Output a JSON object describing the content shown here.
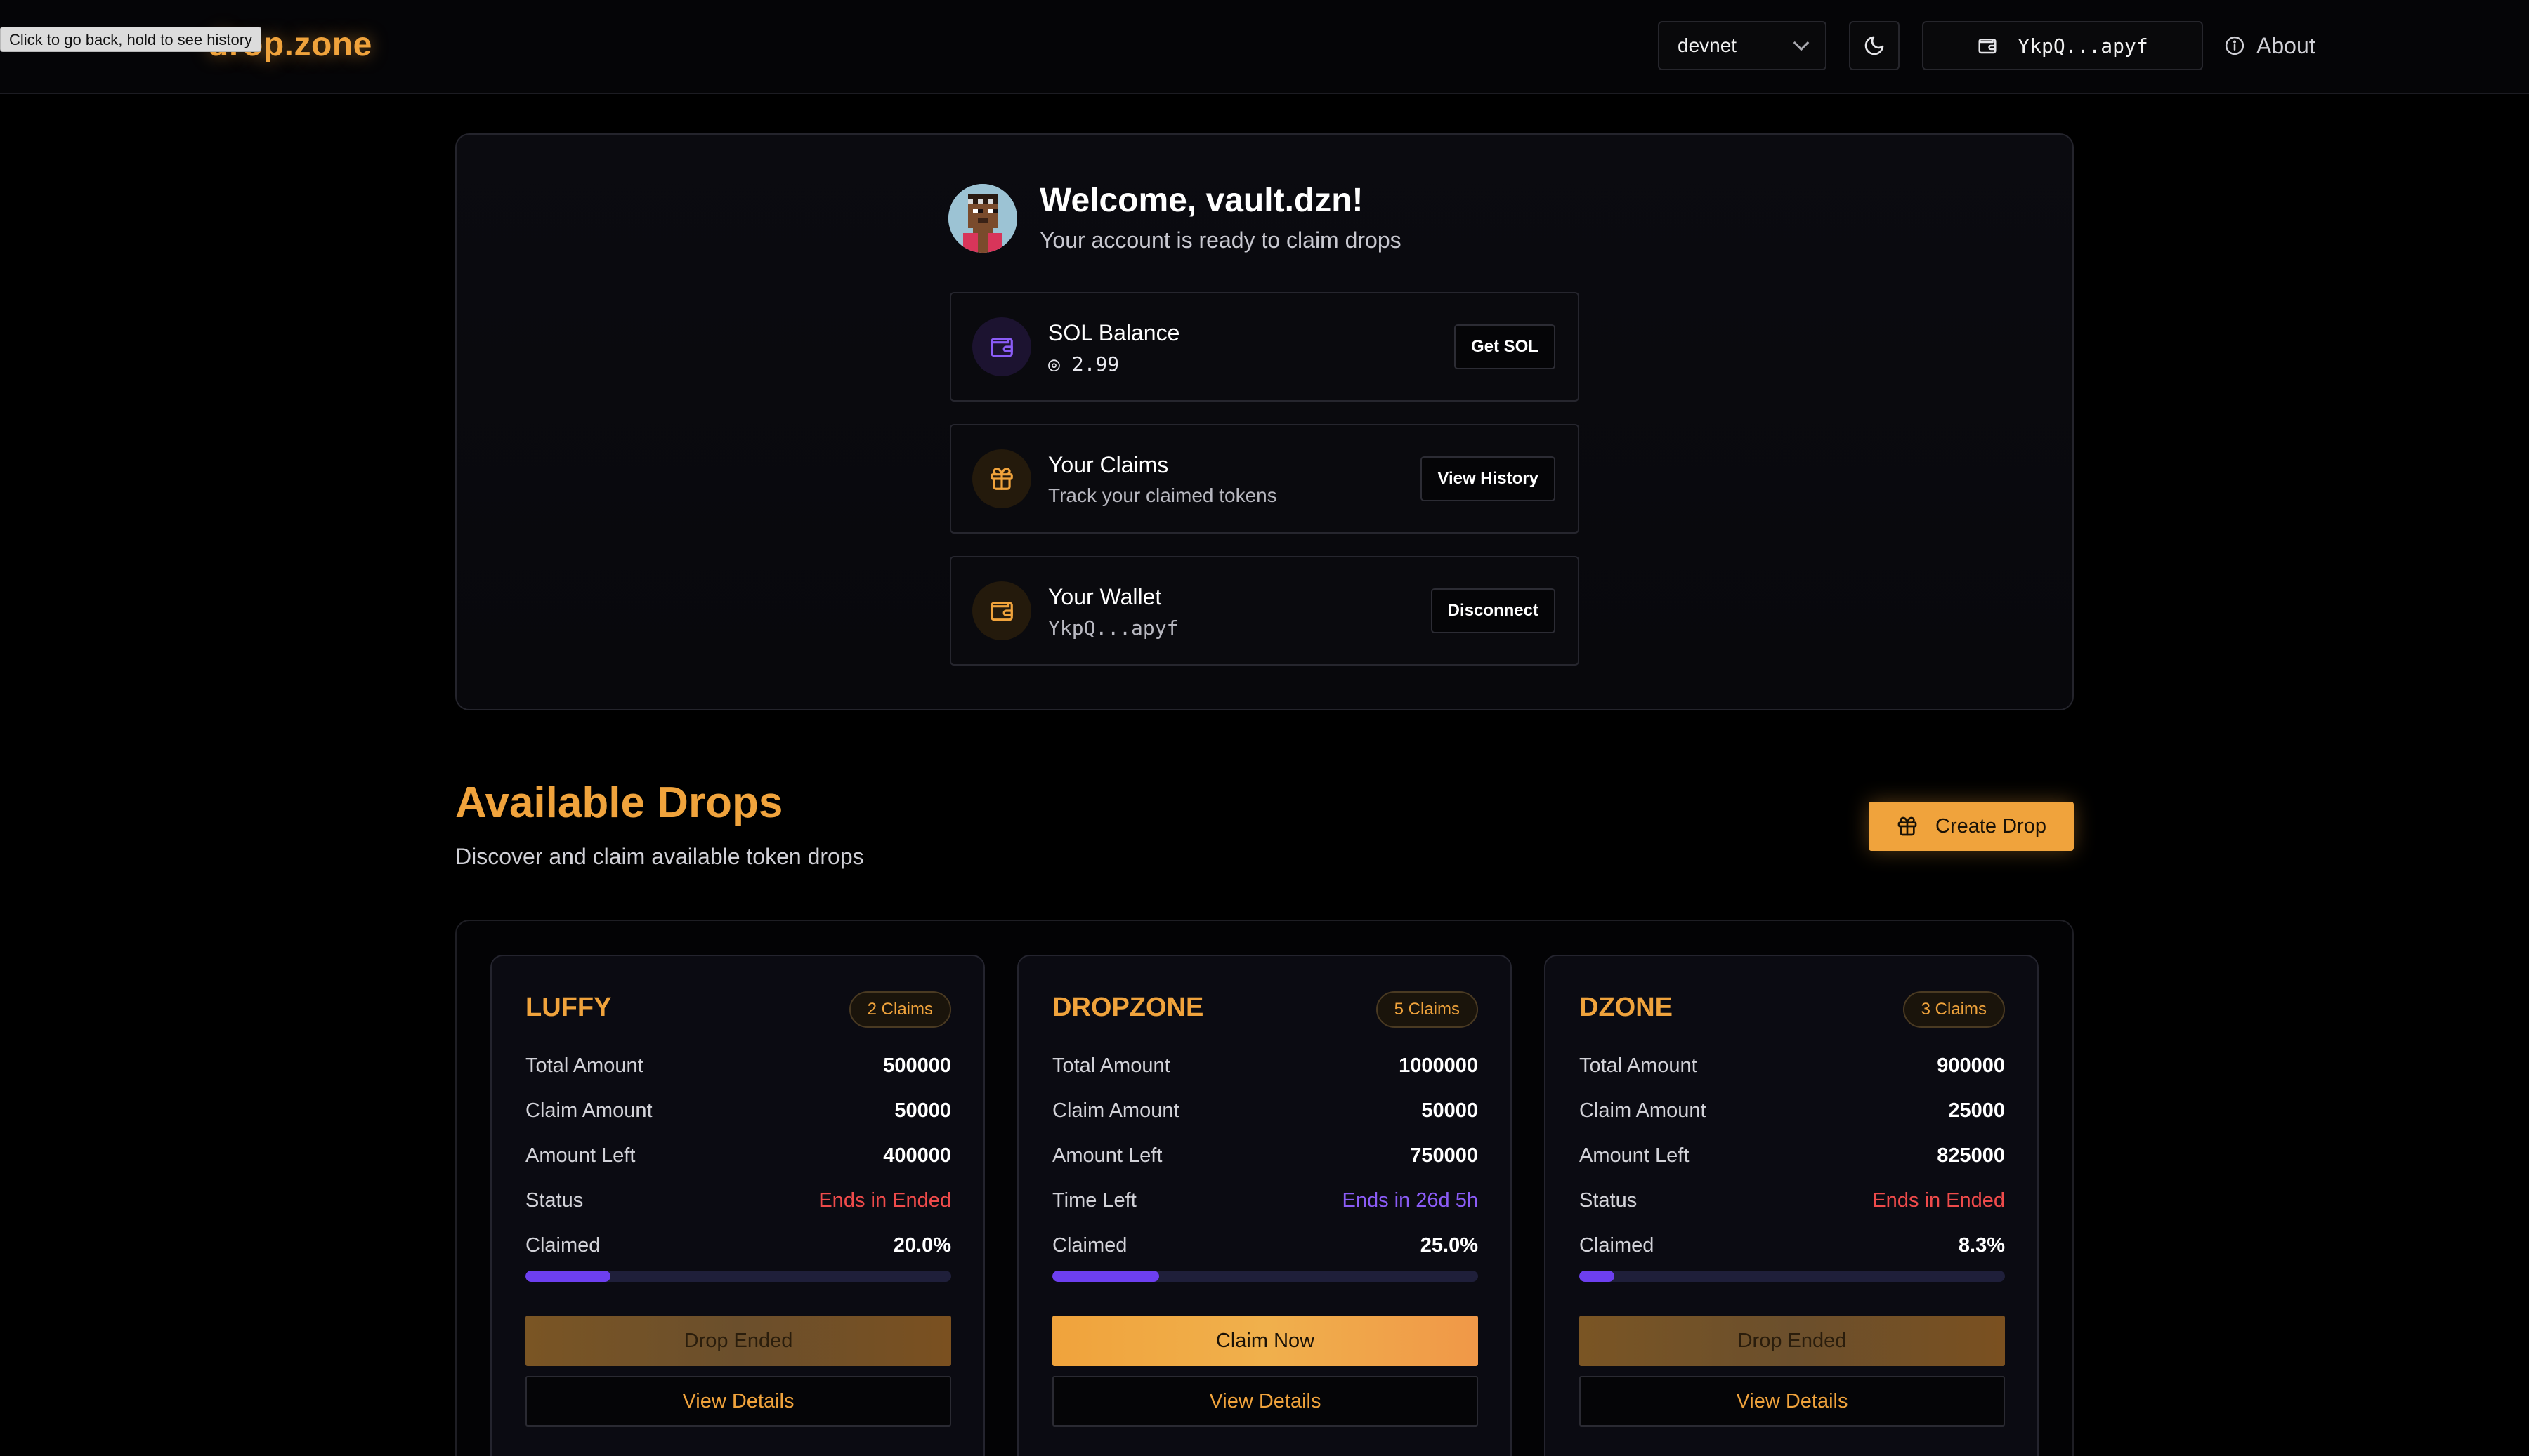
{
  "header": {
    "logo": "drop.zone",
    "back_tooltip": "Click to go back, hold to see history",
    "network": "devnet",
    "wallet_short": "YkpQ...apyf",
    "about_label": "About"
  },
  "welcome": {
    "title": "Welcome, vault.dzn!",
    "subtitle": "Your account is ready to claim drops",
    "cards": [
      {
        "title": "SOL Balance",
        "value": "◎ 2.99",
        "button": "Get SOL",
        "icon": "wallet-icon"
      },
      {
        "title": "Your Claims",
        "value": "Track your claimed tokens",
        "button": "View History",
        "icon": "gift-icon"
      },
      {
        "title": "Your Wallet",
        "value": "YkpQ...apyf",
        "button": "Disconnect",
        "icon": "wallet-icon"
      }
    ]
  },
  "drops_section": {
    "title": "Available Drops",
    "subtitle": "Discover and claim available token drops",
    "create_label": "Create Drop"
  },
  "drops": [
    {
      "name": "LUFFY",
      "claims_badge": "2 Claims",
      "rows": [
        {
          "k": "Total Amount",
          "v": "500000"
        },
        {
          "k": "Claim Amount",
          "v": "50000"
        },
        {
          "k": "Amount Left",
          "v": "400000"
        },
        {
          "k": "Status",
          "v": "Ends in Ended"
        },
        {
          "k": "Claimed",
          "v": "20.0%"
        }
      ],
      "claimed_fraction": 0.2,
      "action": "Drop Ended",
      "details": "View Details"
    },
    {
      "name": "DROPZONE",
      "claims_badge": "5 Claims",
      "rows": [
        {
          "k": "Total Amount",
          "v": "1000000"
        },
        {
          "k": "Claim Amount",
          "v": "50000"
        },
        {
          "k": "Amount Left",
          "v": "750000"
        },
        {
          "k": "Time Left",
          "v": "Ends in 26d 5h"
        },
        {
          "k": "Claimed",
          "v": "25.0%"
        }
      ],
      "claimed_fraction": 0.25,
      "action": "Claim Now",
      "details": "View Details"
    },
    {
      "name": "DZONE",
      "claims_badge": "3 Claims",
      "rows": [
        {
          "k": "Total Amount",
          "v": "900000"
        },
        {
          "k": "Claim Amount",
          "v": "25000"
        },
        {
          "k": "Amount Left",
          "v": "825000"
        },
        {
          "k": "Status",
          "v": "Ends in Ended"
        },
        {
          "k": "Claimed",
          "v": "8.3%"
        }
      ],
      "claimed_fraction": 0.083,
      "action": "Drop Ended",
      "details": "View Details"
    }
  ],
  "colors": {
    "accent": "#f0a33c",
    "progress": "#6d3ff0",
    "ended": "#ef4b4b",
    "time_left": "#8b5cf6",
    "background": "#000000"
  }
}
